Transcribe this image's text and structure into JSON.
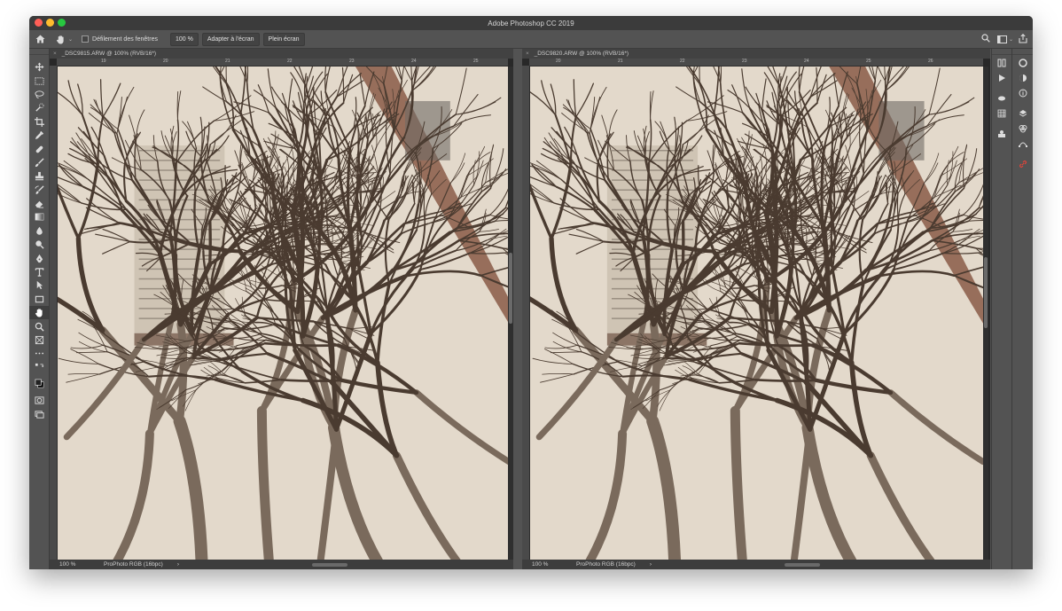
{
  "app": {
    "title": "Adobe Photoshop CC 2019"
  },
  "options_bar": {
    "scroll_all_windows_label": "Défilement des fenêtres",
    "zoom_value": "100 %",
    "fit_screen_label": "Adapter à l'écran",
    "fill_screen_label": "Plein écran"
  },
  "documents": [
    {
      "tab_title": "_DSC9815.ARW @ 100% (RVB/16*)",
      "ruler_ticks": [
        "19",
        "20",
        "21",
        "22",
        "23",
        "24",
        "25"
      ],
      "status_zoom": "100 %",
      "status_profile": "ProPhoto RGB (16bpc)",
      "status_arrow": "›"
    },
    {
      "tab_title": "_DSC9820.ARW @ 100% (RVB/16*)",
      "ruler_ticks": [
        "20",
        "21",
        "22",
        "23",
        "24",
        "25",
        "26"
      ],
      "status_zoom": "100 %",
      "status_profile": "ProPhoto RGB (16bpc)",
      "status_arrow": "›"
    }
  ],
  "tools": [
    "move-tool",
    "marquee-tool",
    "lasso-tool",
    "quick-select-tool",
    "crop-tool",
    "eyedropper-tool",
    "healing-brush-tool",
    "brush-tool",
    "clone-stamp-tool",
    "history-brush-tool",
    "eraser-tool",
    "gradient-tool",
    "blur-tool",
    "dodge-tool",
    "pen-tool",
    "type-tool",
    "path-select-tool",
    "rectangle-tool",
    "hand-tool",
    "zoom-tool",
    "frame-tool",
    "more-tools",
    "swap-colors",
    "color-swatches",
    "quick-mask",
    "screen-mode"
  ],
  "colors": {
    "ui_background": "#535353",
    "titlebar": "#3b3b3b",
    "canvas_wall": "#e3d9cb",
    "branch_dark": "#4a3b30",
    "roof_edge": "#8a5a48",
    "close_red": "#ff5f57",
    "minimize_yellow": "#febc2e",
    "zoom_green": "#28c840",
    "link_icon_red": "#e0443a"
  }
}
